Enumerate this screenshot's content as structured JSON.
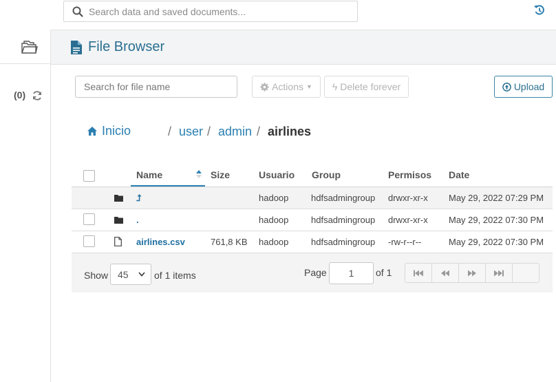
{
  "topbar": {
    "search_placeholder": "Search data and saved documents..."
  },
  "rail": {
    "job_count": "(0)"
  },
  "header": {
    "title": "File Browser"
  },
  "toolbar": {
    "file_search_placeholder": "Search for file name",
    "actions_label": "Actions",
    "delete_label": "Delete forever",
    "upload_label": "Upload"
  },
  "breadcrumb": {
    "home": "Inicio",
    "sep": "/",
    "items": [
      "user",
      "admin",
      "airlines"
    ]
  },
  "table": {
    "columns": [
      "Name",
      "Size",
      "Usuario",
      "Group",
      "Permisos",
      "Date"
    ],
    "rows": [
      {
        "name": "⮥",
        "size": "",
        "user": "hadoop",
        "group": "hdfsadmingroup",
        "perms": "drwxr-xr-x",
        "date": "May 29, 2022 07:29 PM",
        "type": "folder"
      },
      {
        "name": ".",
        "size": "",
        "user": "hadoop",
        "group": "hdfsadmingroup",
        "perms": "drwxr-xr-x",
        "date": "May 29, 2022 07:30 PM",
        "type": "folder"
      },
      {
        "name": "airlines.csv",
        "size": "761,8 KB",
        "user": "hadoop",
        "group": "hdfsadmingroup",
        "perms": "-rw-r--r--",
        "date": "May 29, 2022 07:30 PM",
        "type": "file"
      }
    ]
  },
  "pager": {
    "show_label": "Show",
    "page_size": "45",
    "of_items": "of 1 items",
    "page_label": "Page",
    "page_value": "1",
    "of_pages": "of 1"
  },
  "colors": {
    "accent": "#2a7fb0",
    "title": "#2a6f91"
  }
}
